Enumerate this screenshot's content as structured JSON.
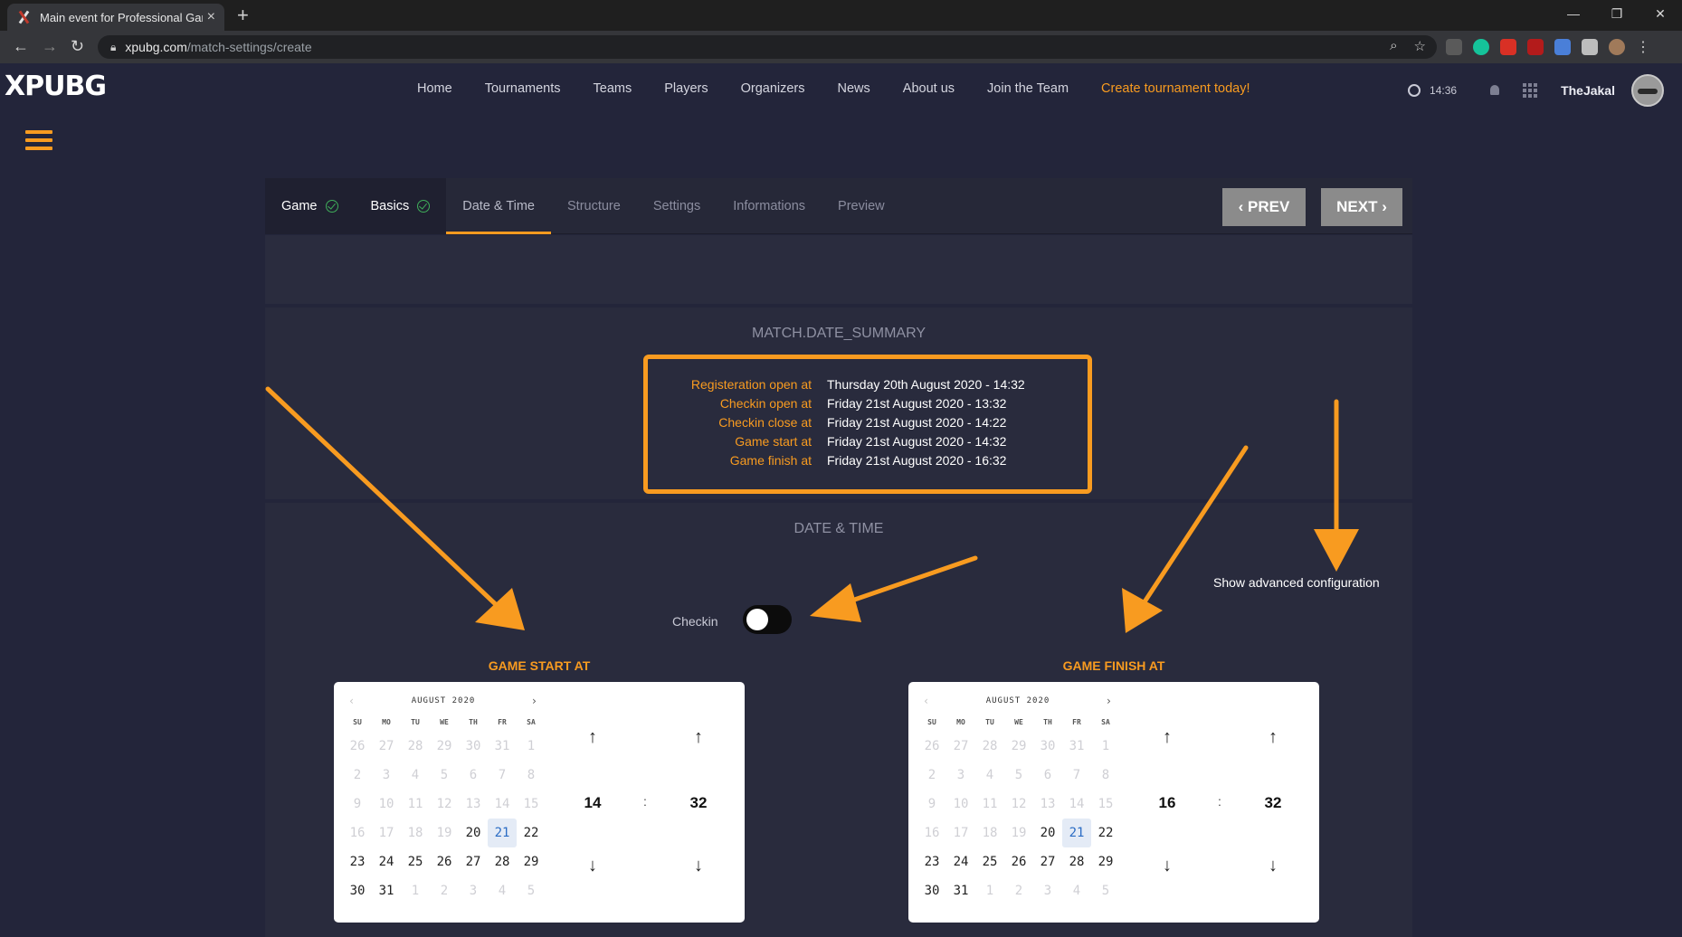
{
  "browser": {
    "tab_title": "Main event for Professional Gam",
    "url_domain": "xpubg.com",
    "url_path": "/match-settings/create"
  },
  "site": {
    "logo": "XPUBG",
    "nav": [
      "Home",
      "Tournaments",
      "Teams",
      "Players",
      "Organizers",
      "News",
      "About us",
      "Join the Team",
      "Create tournament today!"
    ],
    "time": "14:36",
    "username": "TheJakal"
  },
  "wizard": {
    "steps": [
      {
        "label": "Game",
        "state": "done"
      },
      {
        "label": "Basics",
        "state": "done"
      },
      {
        "label": "Date & Time",
        "state": "active"
      },
      {
        "label": "Structure",
        "state": "todo"
      },
      {
        "label": "Settings",
        "state": "todo"
      },
      {
        "label": "Informations",
        "state": "todo"
      },
      {
        "label": "Preview",
        "state": "todo"
      }
    ],
    "prev_label": "PREV",
    "next_label": "NEXT"
  },
  "summary": {
    "title": "MATCH.DATE_SUMMARY",
    "rows": [
      {
        "k": "Registeration open at",
        "v": "Thursday 20th August 2020 - 14:32"
      },
      {
        "k": "Checkin open at",
        "v": "Friday 21st August 2020 - 13:32"
      },
      {
        "k": "Checkin close at",
        "v": "Friday 21st August 2020 - 14:22"
      },
      {
        "k": "Game start at",
        "v": "Friday 21st August 2020 - 14:32"
      },
      {
        "k": "Game finish at",
        "v": "Friday 21st August 2020 - 16:32"
      }
    ]
  },
  "datetime": {
    "title": "DATE & TIME",
    "advanced": "Show advanced configuration",
    "checkin_label": "Checkin",
    "checkin_enabled": false,
    "dow": [
      "SU",
      "MO",
      "TU",
      "WE",
      "TH",
      "FR",
      "SA"
    ],
    "start": {
      "label": "GAME START AT",
      "month": "AUGUST 2020",
      "hour": "14",
      "minute": "32",
      "selected_day": "21"
    },
    "finish": {
      "label": "GAME FINISH AT",
      "month": "AUGUST 2020",
      "hour": "16",
      "minute": "32",
      "selected_day": "21"
    },
    "days": [
      {
        "d": "26",
        "s": "mute"
      },
      {
        "d": "27",
        "s": "mute"
      },
      {
        "d": "28",
        "s": "mute"
      },
      {
        "d": "29",
        "s": "mute"
      },
      {
        "d": "30",
        "s": "mute"
      },
      {
        "d": "31",
        "s": "mute"
      },
      {
        "d": "1",
        "s": "mute"
      },
      {
        "d": "2",
        "s": "mute"
      },
      {
        "d": "3",
        "s": "mute"
      },
      {
        "d": "4",
        "s": "mute"
      },
      {
        "d": "5",
        "s": "mute"
      },
      {
        "d": "6",
        "s": "mute"
      },
      {
        "d": "7",
        "s": "mute"
      },
      {
        "d": "8",
        "s": "mute"
      },
      {
        "d": "9",
        "s": "mute"
      },
      {
        "d": "10",
        "s": "mute"
      },
      {
        "d": "11",
        "s": "mute"
      },
      {
        "d": "12",
        "s": "mute"
      },
      {
        "d": "13",
        "s": "mute"
      },
      {
        "d": "14",
        "s": "mute"
      },
      {
        "d": "15",
        "s": "mute"
      },
      {
        "d": "16",
        "s": "mute"
      },
      {
        "d": "17",
        "s": "mute"
      },
      {
        "d": "18",
        "s": "mute"
      },
      {
        "d": "19",
        "s": "mute"
      },
      {
        "d": "20",
        "s": ""
      },
      {
        "d": "21",
        "s": "sel"
      },
      {
        "d": "22",
        "s": ""
      },
      {
        "d": "23",
        "s": ""
      },
      {
        "d": "24",
        "s": ""
      },
      {
        "d": "25",
        "s": ""
      },
      {
        "d": "26",
        "s": ""
      },
      {
        "d": "27",
        "s": ""
      },
      {
        "d": "28",
        "s": ""
      },
      {
        "d": "29",
        "s": ""
      },
      {
        "d": "30",
        "s": ""
      },
      {
        "d": "31",
        "s": ""
      },
      {
        "d": "1",
        "s": "mute"
      },
      {
        "d": "2",
        "s": "mute"
      },
      {
        "d": "3",
        "s": "mute"
      },
      {
        "d": "4",
        "s": "mute"
      },
      {
        "d": "5",
        "s": "mute"
      }
    ]
  },
  "colors": {
    "accent": "#f89b20",
    "bg": "#23253a",
    "panel": "#292b3d",
    "success": "#3fae5a"
  }
}
